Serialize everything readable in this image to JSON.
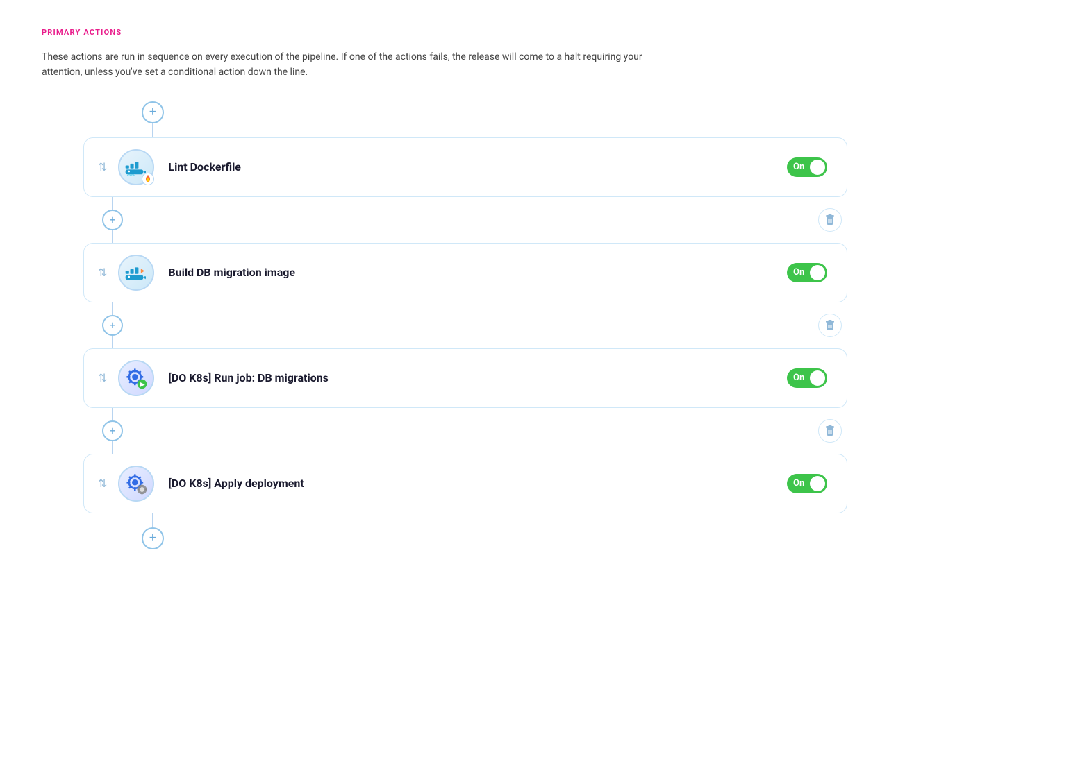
{
  "section": {
    "title": "PRIMARY ACTIONS",
    "description": "These actions are run in sequence on every execution of the pipeline. If one of the actions fails, the release will come to a halt requiring your attention, unless you've set a conditional action down the line."
  },
  "actions": [
    {
      "id": "lint-dockerfile",
      "name": "Lint Dockerfile",
      "icon_type": "docker-lint",
      "toggle_label": "On",
      "toggle_on": true
    },
    {
      "id": "build-db-migration",
      "name": "Build DB migration image",
      "icon_type": "docker-build",
      "toggle_label": "On",
      "toggle_on": true
    },
    {
      "id": "do-k8s-run-job",
      "name": "[DO K8s] Run job: DB migrations",
      "icon_type": "k8s-run",
      "toggle_label": "On",
      "toggle_on": true
    },
    {
      "id": "do-k8s-apply-deployment",
      "name": "[DO K8s] Apply deployment",
      "icon_type": "k8s-deploy",
      "toggle_label": "On",
      "toggle_on": true
    }
  ],
  "buttons": {
    "add_label": "+",
    "drag_handle": "⇅",
    "delete_icon": "⏳"
  },
  "colors": {
    "primary_actions_title": "#e91e8c",
    "toggle_on": "#3dc44a",
    "connector": "#b8d4f0",
    "border": "#d0e8f8"
  }
}
